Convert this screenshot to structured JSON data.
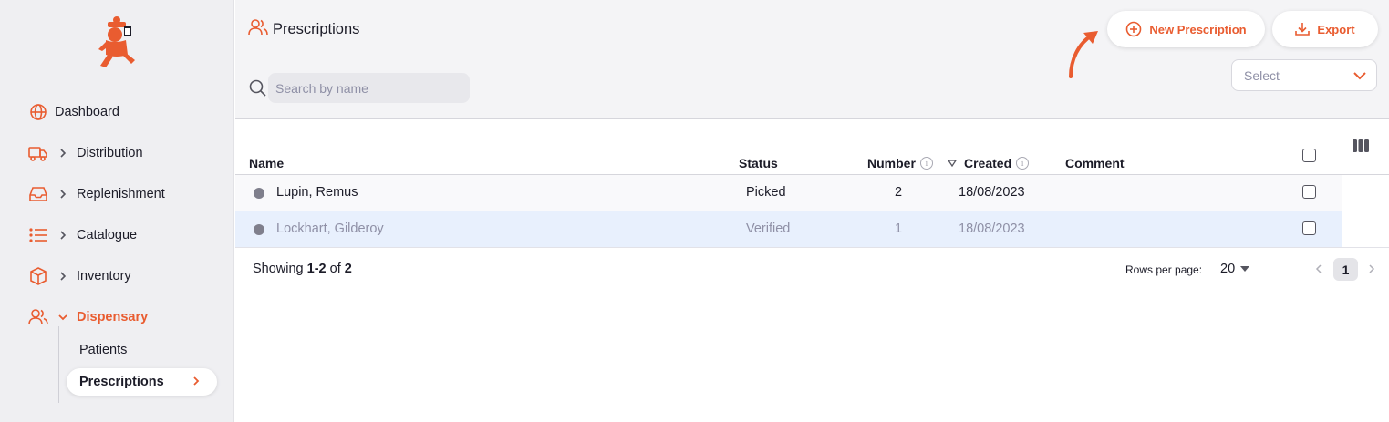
{
  "sidebar": {
    "nav": [
      {
        "label": "Dashboard",
        "icon": "globe-icon"
      },
      {
        "label": "Distribution",
        "icon": "truck-icon"
      },
      {
        "label": "Replenishment",
        "icon": "inbox-icon"
      },
      {
        "label": "Catalogue",
        "icon": "list-icon"
      },
      {
        "label": "Inventory",
        "icon": "box-icon"
      },
      {
        "label": "Dispensary",
        "icon": "users-icon",
        "active": true
      }
    ],
    "sub_items": [
      {
        "label": "Patients"
      },
      {
        "label": "Prescriptions",
        "selected": true
      }
    ]
  },
  "header": {
    "title": "Prescriptions",
    "new_button": "New Prescription",
    "export_button": "Export",
    "search_placeholder": "Search by name",
    "select_placeholder": "Select"
  },
  "table": {
    "columns": {
      "name": "Name",
      "status": "Status",
      "number": "Number",
      "created": "Created",
      "comment": "Comment"
    },
    "rows": [
      {
        "name": "Lupin, Remus",
        "status": "Picked",
        "number": "2",
        "created": "18/08/2023",
        "comment": ""
      },
      {
        "name": "Lockhart, Gilderoy",
        "status": "Verified",
        "number": "1",
        "created": "18/08/2023",
        "comment": ""
      }
    ]
  },
  "footer": {
    "showing_prefix": "Showing ",
    "showing_range": "1-2",
    "showing_of": " of ",
    "showing_total": "2",
    "rows_per_page_label": "Rows per page:",
    "rows_per_page_value": "20",
    "current_page": "1"
  },
  "colors": {
    "accent": "#e95c30",
    "sidebar_bg": "#efeff2",
    "selected_row": "#e8f0fd"
  }
}
